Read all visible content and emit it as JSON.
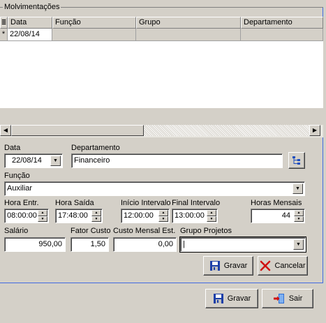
{
  "group": {
    "title": "Molvimentações"
  },
  "grid": {
    "columns": [
      "Data",
      "Função",
      "Grupo",
      "Departamento"
    ],
    "row_marker": "*",
    "rows": [
      {
        "data": "22/08/14",
        "funcao": "",
        "grupo": "",
        "departamento": ""
      }
    ]
  },
  "form": {
    "data_label": "Data",
    "data_value": "22/08/14",
    "departamento_label": "Departamento",
    "departamento_value": "Financeiro",
    "funcao_label": "Função",
    "funcao_value": "Auxiliar",
    "hora_entr_label": "Hora Entr.",
    "hora_entr_value": "08:00:00",
    "hora_saida_label": "Hora Saída",
    "hora_saida_value": "17:48:00",
    "inicio_intervalo_label": "Início Intervalo",
    "inicio_intervalo_value": "12:00:00",
    "final_intervalo_label": "Final Intervalo",
    "final_intervalo_value": "13:00:00",
    "horas_mensais_label": "Horas Mensais",
    "horas_mensais_value": "44",
    "salario_label": "Salário",
    "salario_value": "950,00",
    "fator_custo_label": "Fator Custo",
    "fator_custo_value": "1,50",
    "custo_mensal_label": "Custo Mensal Est.",
    "custo_mensal_value": "0,00",
    "grupo_projetos_label": "Grupo Projetos",
    "grupo_projetos_value": "|"
  },
  "inner_buttons": {
    "gravar": "Gravar",
    "cancelar": "Cancelar"
  },
  "outer_buttons": {
    "gravar": "Gravar",
    "sair": "Sair"
  },
  "colors": {
    "group_border": "#4169e1",
    "window_bg": "#d4d0c8"
  }
}
